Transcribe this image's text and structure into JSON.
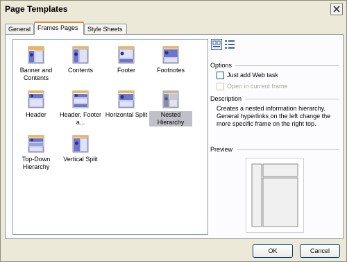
{
  "window": {
    "title": "Page Templates"
  },
  "tabs": [
    {
      "label": "General"
    },
    {
      "label": "Frames Pages"
    },
    {
      "label": "Style Sheets"
    }
  ],
  "templates": [
    {
      "label": "Banner and Contents",
      "icon": "banner-contents-template-icon",
      "selected": false
    },
    {
      "label": "Contents",
      "icon": "contents-template-icon",
      "selected": false
    },
    {
      "label": "Footer",
      "icon": "footer-template-icon",
      "selected": false
    },
    {
      "label": "Footnotes",
      "icon": "footnotes-template-icon",
      "selected": false
    },
    {
      "label": "Header",
      "icon": "header-template-icon",
      "selected": false
    },
    {
      "label": "Header, Footer a...",
      "icon": "header-footer-template-icon",
      "selected": false
    },
    {
      "label": "Horizontal Split",
      "icon": "horizontal-split-template-icon",
      "selected": false
    },
    {
      "label": "Nested Hierarchy",
      "icon": "nested-hierarchy-template-icon",
      "selected": true
    },
    {
      "label": "Top-Down Hierarchy",
      "icon": "top-down-hierarchy-template-icon",
      "selected": false
    },
    {
      "label": "Vertical Split",
      "icon": "vertical-split-template-icon",
      "selected": false
    }
  ],
  "options": {
    "heading": "Options",
    "just_add_web_task": "Just add Web task",
    "open_in_current_frame": "Open in current frame"
  },
  "description": {
    "heading": "Description",
    "text": "Creates a nested information hierarchy.  General hyperlinks on the left change the more specific frame on the right top."
  },
  "preview": {
    "heading": "Preview"
  },
  "buttons": {
    "ok": "OK",
    "cancel": "Cancel"
  },
  "colors": {
    "accent_tab": "#e68b2c",
    "selection": "#c0c0c8",
    "dialog_bg": "#ece9d8"
  }
}
